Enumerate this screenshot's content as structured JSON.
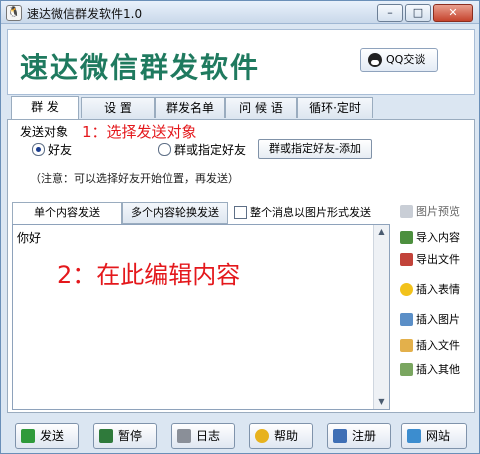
{
  "window": {
    "title": "速达微信群发软件1.0",
    "controls": {
      "minimize": "–",
      "maximize": "□",
      "close": "✕"
    }
  },
  "header": {
    "app_name": "速达微信群发软件",
    "qq_button": "QQ交谈"
  },
  "tabs": [
    "群 发",
    "设 置",
    "群发名单",
    "问 候 语",
    "循环·定时"
  ],
  "send_target": {
    "label": "发送对象",
    "annotation": "1：选择发送对象",
    "options": [
      "好友",
      "群或指定好友"
    ],
    "selected": "好友",
    "add_button": "群或指定好友-添加",
    "note": "（注意：可以选择好友开始位置，再发送）"
  },
  "content": {
    "tabs": [
      "单个内容发送",
      "多个内容轮换发送"
    ],
    "active_tab": "单个内容发送",
    "image_send_checkbox": "整个消息以图片形式发送",
    "image_send_checked": false,
    "image_preview_label": "图片预览",
    "editor_text": "你好",
    "annotation": "2：在此编辑内容"
  },
  "sidebar": {
    "import": "导入内容",
    "export": "导出文件",
    "emoji": "插入表情",
    "picture": "插入图片",
    "file": "插入文件",
    "other": "插入其他"
  },
  "bottom_buttons": {
    "send": "发送",
    "pause": "暂停",
    "log": "日志",
    "help": "帮助",
    "register": "注册",
    "website": "网站"
  },
  "colors": {
    "app_name": "#1f7a5f",
    "annotation": "#e4181c",
    "window_bg": "#dbe6f2"
  }
}
